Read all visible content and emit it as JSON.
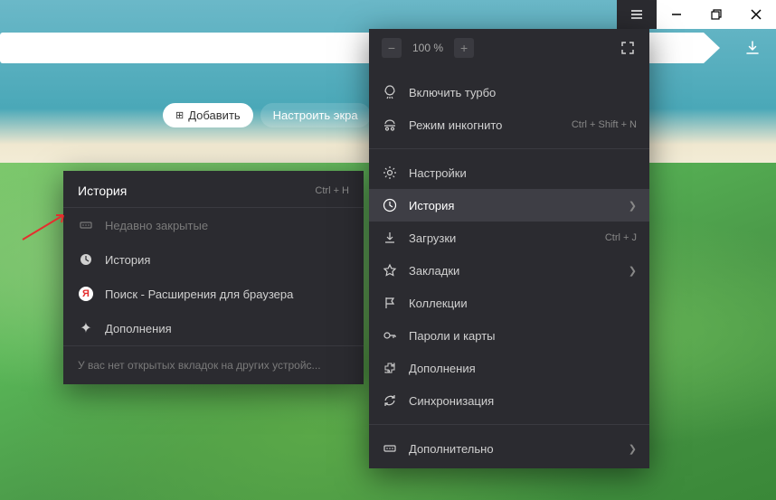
{
  "zoom": {
    "value": "100 %"
  },
  "buttons": {
    "add": "Добавить",
    "customize": "Настроить экра"
  },
  "menu": {
    "turbo": "Включить турбо",
    "incognito": "Режим инкогнито",
    "incognito_shortcut": "Ctrl + Shift + N",
    "settings": "Настройки",
    "history": "История",
    "downloads": "Загрузки",
    "downloads_shortcut": "Ctrl + J",
    "bookmarks": "Закладки",
    "collections": "Коллекции",
    "passwords": "Пароли и карты",
    "extensions": "Дополнения",
    "sync": "Синхронизация",
    "more": "Дополнительно"
  },
  "submenu": {
    "title": "История",
    "shortcut": "Ctrl + H",
    "recent_closed": "Недавно закрытые",
    "history": "История",
    "search_ext": "Поиск - Расширения для браузера",
    "addons": "Дополнения",
    "footer": "У вас нет открытых вкладок на других устройс..."
  }
}
